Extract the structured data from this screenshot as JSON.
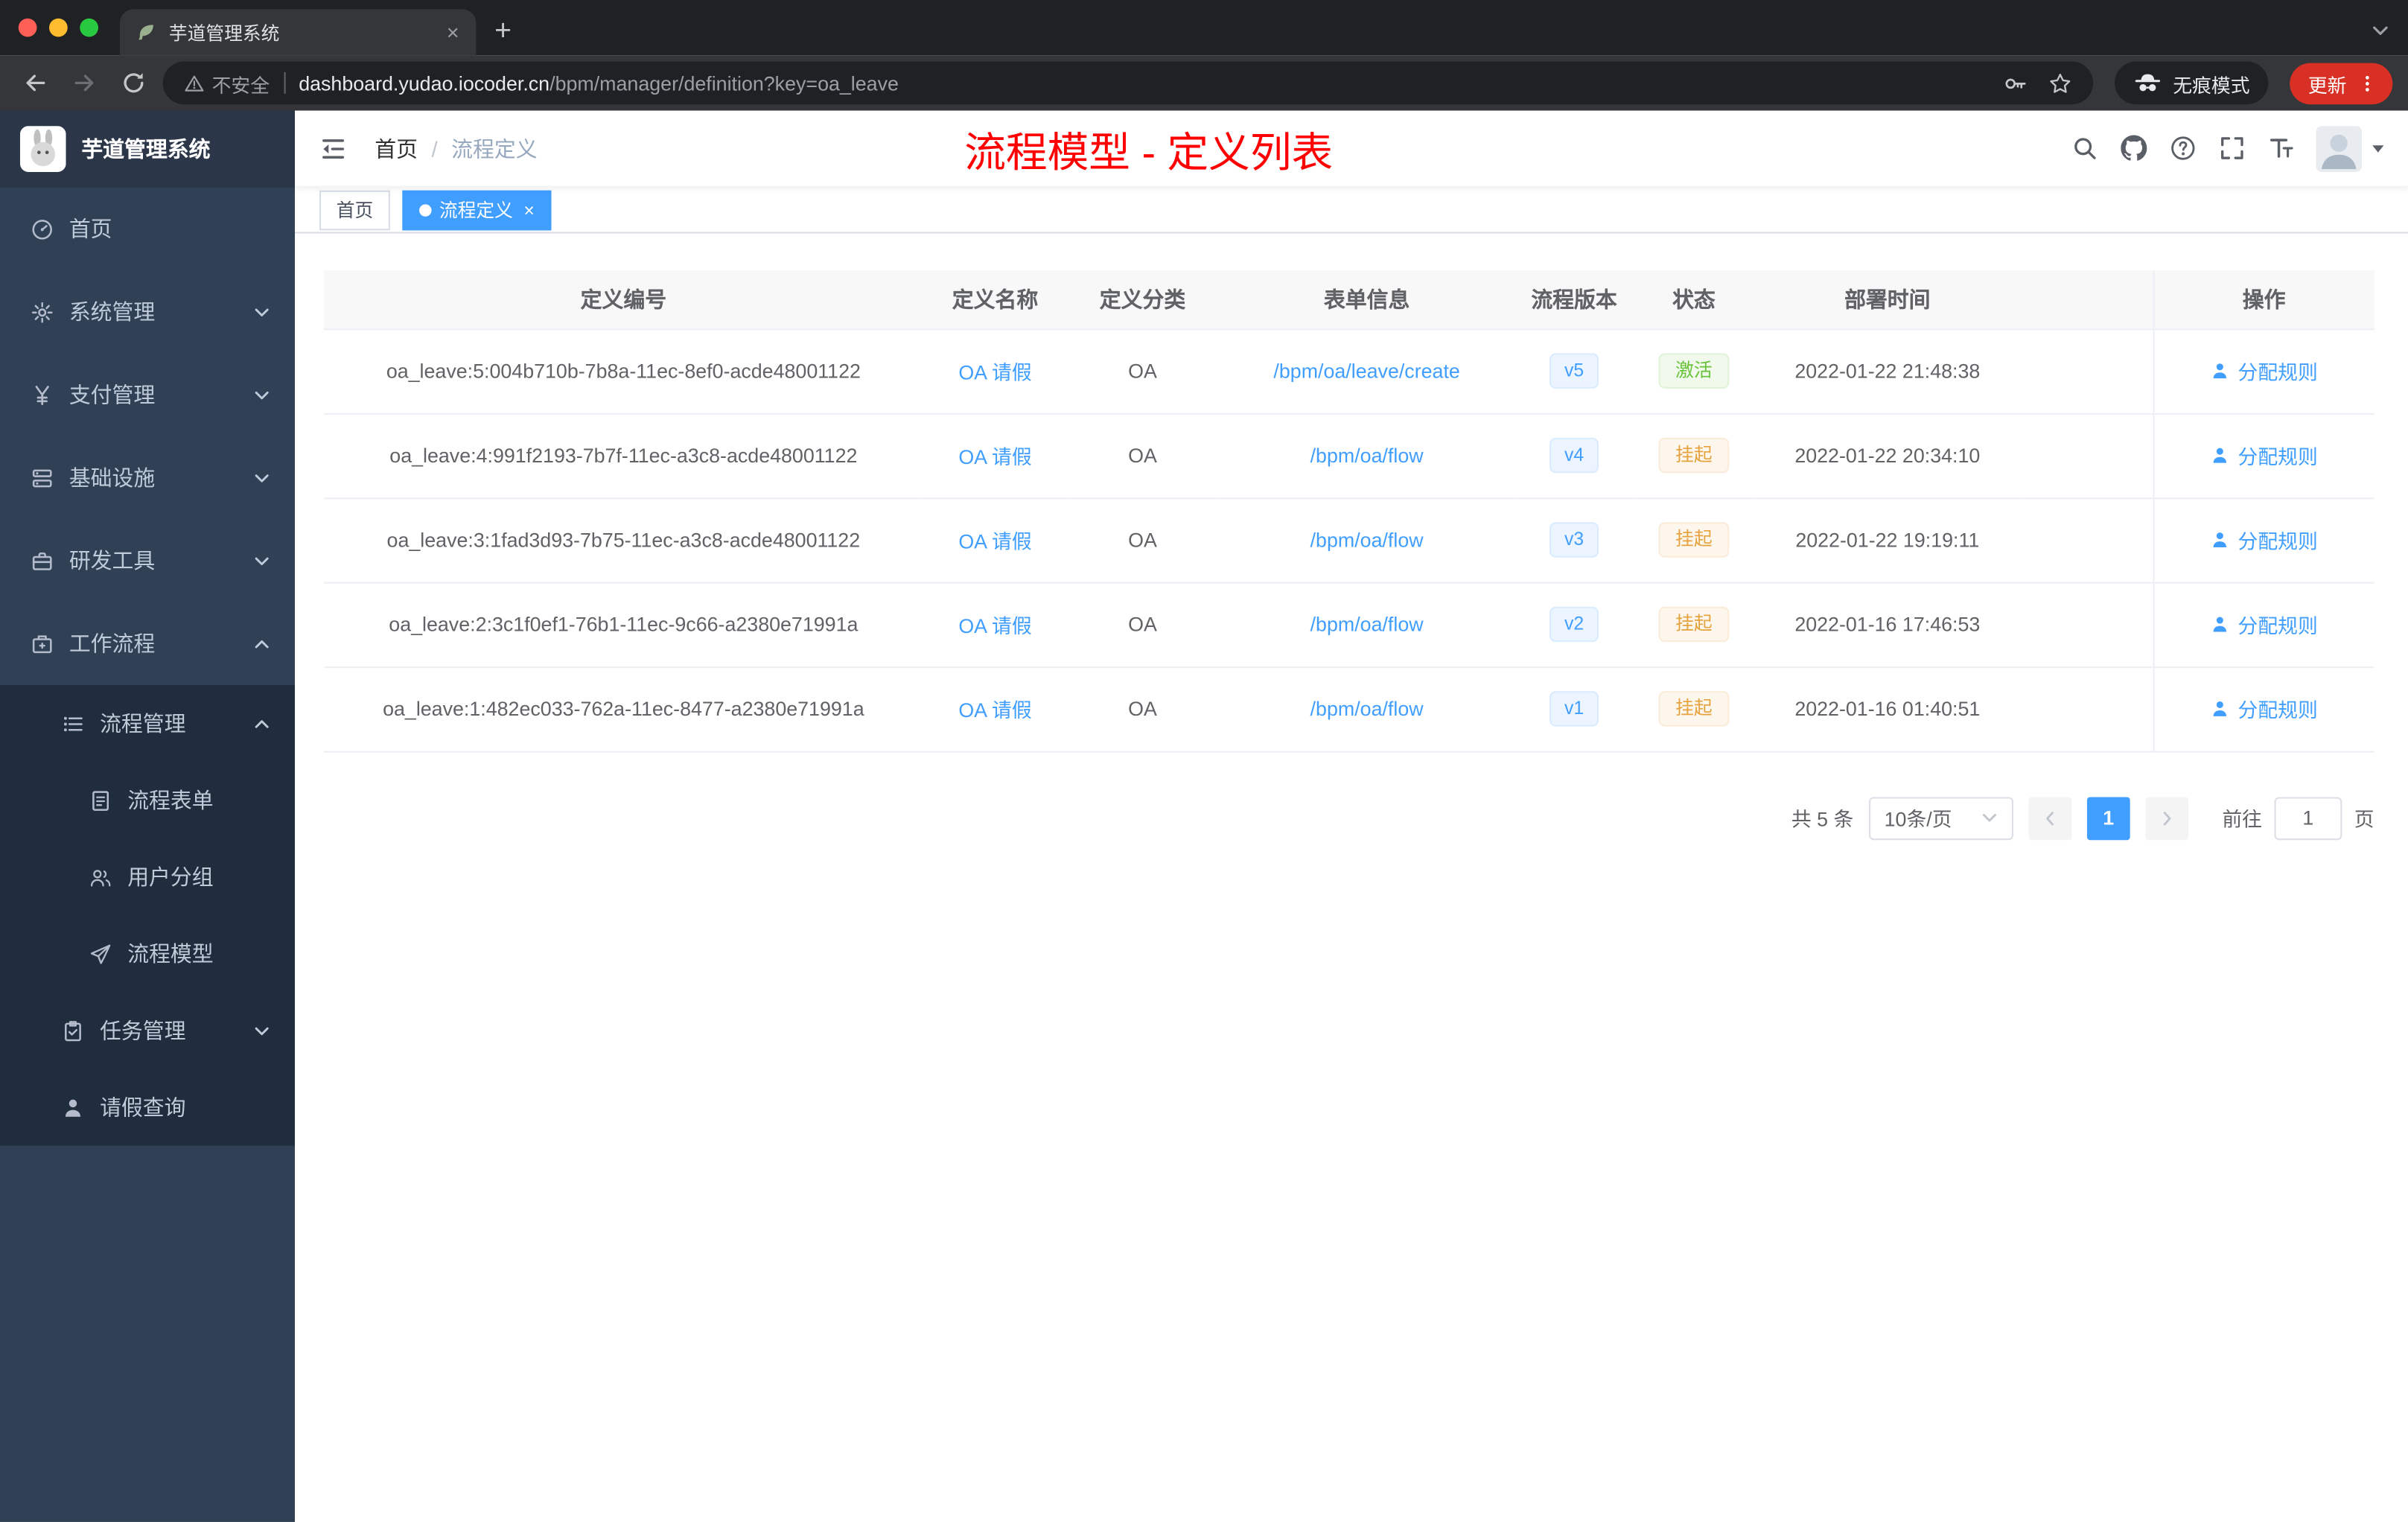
{
  "colors": {
    "primary": "#409eff",
    "success": "#67c23a",
    "warning": "#e6a23c",
    "annotation": "#ff0000",
    "sidebar_bg": "#304156",
    "sidebar_sub_bg": "#1f2d3d",
    "chrome_update": "#d93025"
  },
  "browser": {
    "traffic_lights": [
      "#ff5f57",
      "#febc2e",
      "#28c840"
    ],
    "tab": {
      "title": "芋道管理系统",
      "favicon": "leaf-icon"
    },
    "toolbar_icons": [
      "back-icon",
      "forward-icon",
      "reload-icon"
    ],
    "address": {
      "security_label": "不安全",
      "host": "dashboard.yudao.iocoder.cn",
      "path": "/bpm/manager/definition?key=oa_leave",
      "icons": [
        "warning-icon",
        "key-icon",
        "star-icon"
      ]
    },
    "incognito_label": "无痕模式",
    "update_label": "更新"
  },
  "sidebar": {
    "logo_title": "芋道管理系统",
    "items": [
      {
        "key": "home",
        "label": "首页",
        "icon": "dashboard-icon",
        "depth": 0
      },
      {
        "key": "system",
        "label": "系统管理",
        "icon": "gear-icon",
        "depth": 0,
        "arrow": "down"
      },
      {
        "key": "payment",
        "label": "支付管理",
        "icon": "yen-icon",
        "depth": 0,
        "arrow": "down"
      },
      {
        "key": "infrastructure",
        "label": "基础设施",
        "icon": "infrastructure-icon",
        "depth": 0,
        "arrow": "down"
      },
      {
        "key": "dev-tools",
        "label": "研发工具",
        "icon": "tools-icon",
        "depth": 0,
        "arrow": "down"
      },
      {
        "key": "workflow",
        "label": "工作流程",
        "icon": "workflow-icon",
        "depth": 0,
        "arrow": "up"
      },
      {
        "key": "process-manage",
        "label": "流程管理",
        "icon": "process-icon",
        "depth": 1,
        "arrow": "up"
      },
      {
        "key": "process-form",
        "label": "流程表单",
        "icon": "form-icon",
        "depth": 2
      },
      {
        "key": "user-group",
        "label": "用户分组",
        "icon": "user-group-icon",
        "depth": 2
      },
      {
        "key": "process-model",
        "label": "流程模型",
        "icon": "model-icon",
        "depth": 2
      },
      {
        "key": "task-manage",
        "label": "任务管理",
        "icon": "task-icon",
        "depth": 1,
        "arrow": "down"
      },
      {
        "key": "leave-query",
        "label": "请假查询",
        "icon": "leave-icon",
        "depth": 1
      }
    ]
  },
  "header": {
    "breadcrumb": {
      "home": "首页",
      "separator": "/",
      "current": "流程定义"
    },
    "annotation": "流程模型 - 定义列表",
    "right_icons": [
      "search-icon",
      "github-icon",
      "help-icon",
      "fullscreen-icon",
      "font-size-icon"
    ]
  },
  "tags": [
    {
      "key": "home",
      "label": "首页",
      "active": false,
      "closable": false
    },
    {
      "key": "process-definition",
      "label": "流程定义",
      "active": true,
      "closable": true
    }
  ],
  "table": {
    "columns": [
      "定义编号",
      "定义名称",
      "定义分类",
      "表单信息",
      "流程版本",
      "状态",
      "部署时间",
      "操作"
    ],
    "action_label": "分配规则",
    "rows": [
      {
        "id": "oa_leave:5:004b710b-7b8a-11ec-8ef0-acde48001122",
        "name": "OA 请假",
        "category": "OA",
        "form": "/bpm/oa/leave/create",
        "version": "v5",
        "status": "激活",
        "status_type": "success",
        "deploy_time": "2022-01-22 21:48:38"
      },
      {
        "id": "oa_leave:4:991f2193-7b7f-11ec-a3c8-acde48001122",
        "name": "OA 请假",
        "category": "OA",
        "form": "/bpm/oa/flow",
        "version": "v4",
        "status": "挂起",
        "status_type": "warning",
        "deploy_time": "2022-01-22 20:34:10"
      },
      {
        "id": "oa_leave:3:1fad3d93-7b75-11ec-a3c8-acde48001122",
        "name": "OA 请假",
        "category": "OA",
        "form": "/bpm/oa/flow",
        "version": "v3",
        "status": "挂起",
        "status_type": "warning",
        "deploy_time": "2022-01-22 19:19:11"
      },
      {
        "id": "oa_leave:2:3c1f0ef1-76b1-11ec-9c66-a2380e71991a",
        "name": "OA 请假",
        "category": "OA",
        "form": "/bpm/oa/flow",
        "version": "v2",
        "status": "挂起",
        "status_type": "warning",
        "deploy_time": "2022-01-16 17:46:53"
      },
      {
        "id": "oa_leave:1:482ec033-762a-11ec-8477-a2380e71991a",
        "name": "OA 请假",
        "category": "OA",
        "form": "/bpm/oa/flow",
        "version": "v1",
        "status": "挂起",
        "status_type": "warning",
        "deploy_time": "2022-01-16 01:40:51"
      }
    ]
  },
  "pagination": {
    "total": "共 5 条",
    "page_size": "10条/页",
    "current_page": "1",
    "goto_label": "前往",
    "goto_value": "1",
    "page_unit": "页"
  }
}
